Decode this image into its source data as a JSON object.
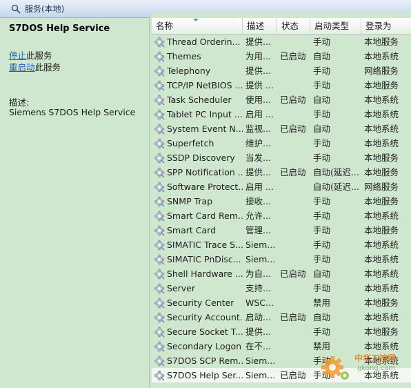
{
  "window": {
    "title": "服务(本地)",
    "icon": "search-icon"
  },
  "left_pane": {
    "service_title": "S7DOS Help Service",
    "stop_link": "停止",
    "stop_suffix": "此服务",
    "restart_link": "重启动",
    "restart_suffix": "此服务",
    "description_label": "描述:",
    "description_text": "Siemens S7DOS Help Service"
  },
  "table": {
    "columns": [
      "名称",
      "描述",
      "状态",
      "启动类型",
      "登录为"
    ],
    "row_icon": "gear-icon",
    "rows": [
      {
        "name": "Thread Orderin...",
        "desc": "提供...",
        "status": "",
        "startup": "手动",
        "logon": "本地服务"
      },
      {
        "name": "Themes",
        "desc": "为用...",
        "status": "已启动",
        "startup": "自动",
        "logon": "本地系统"
      },
      {
        "name": "Telephony",
        "desc": "提供...",
        "status": "",
        "startup": "手动",
        "logon": "网络服务"
      },
      {
        "name": "TCP/IP NetBIOS ...",
        "desc": "提供 ...",
        "status": "",
        "startup": "手动",
        "logon": "本地服务"
      },
      {
        "name": "Task Scheduler",
        "desc": "使用...",
        "status": "已启动",
        "startup": "自动",
        "logon": "本地系统"
      },
      {
        "name": "Tablet PC Input ...",
        "desc": "启用 ...",
        "status": "",
        "startup": "手动",
        "logon": "本地系统"
      },
      {
        "name": "System Event N...",
        "desc": "监视...",
        "status": "已启动",
        "startup": "自动",
        "logon": "本地系统"
      },
      {
        "name": "Superfetch",
        "desc": "维护...",
        "status": "",
        "startup": "手动",
        "logon": "本地系统"
      },
      {
        "name": "SSDP Discovery",
        "desc": "当发...",
        "status": "",
        "startup": "手动",
        "logon": "本地服务"
      },
      {
        "name": "SPP Notification ...",
        "desc": "提供...",
        "status": "已启动",
        "startup": "自动(延迟...",
        "logon": "本地服务"
      },
      {
        "name": "Software Protect...",
        "desc": "启用 ...",
        "status": "",
        "startup": "自动(延迟...",
        "logon": "网络服务"
      },
      {
        "name": "SNMP Trap",
        "desc": "接收...",
        "status": "",
        "startup": "手动",
        "logon": "本地服务"
      },
      {
        "name": "Smart Card Rem...",
        "desc": "允许...",
        "status": "",
        "startup": "手动",
        "logon": "本地系统"
      },
      {
        "name": "Smart Card",
        "desc": "管理...",
        "status": "",
        "startup": "手动",
        "logon": "本地服务"
      },
      {
        "name": "SIMATIC Trace S...",
        "desc": "Siem...",
        "status": "",
        "startup": "手动",
        "logon": "本地系统"
      },
      {
        "name": "SIMATIC PnDisc...",
        "desc": "Siem...",
        "status": "",
        "startup": "手动",
        "logon": "本地系统"
      },
      {
        "name": "Shell Hardware ...",
        "desc": "为自...",
        "status": "已启动",
        "startup": "自动",
        "logon": "本地系统"
      },
      {
        "name": "Server",
        "desc": "支持...",
        "status": "",
        "startup": "手动",
        "logon": "本地系统"
      },
      {
        "name": "Security Center",
        "desc": "WSC...",
        "status": "",
        "startup": "禁用",
        "logon": "本地服务"
      },
      {
        "name": "Security Account...",
        "desc": "启动...",
        "status": "已启动",
        "startup": "自动",
        "logon": "本地系统"
      },
      {
        "name": "Secure Socket T...",
        "desc": "提供...",
        "status": "",
        "startup": "手动",
        "logon": "本地服务"
      },
      {
        "name": "Secondary Logon",
        "desc": "在不...",
        "status": "",
        "startup": "禁用",
        "logon": "本地系统"
      },
      {
        "name": "S7DOS SCP Rem...",
        "desc": "Siem...",
        "status": "",
        "startup": "手动",
        "logon": "本地系统"
      },
      {
        "name": "S7DOS Help Ser...",
        "desc": "Siem...",
        "status": "已启动",
        "startup": "手动",
        "logon": "本地系统",
        "selected": true
      }
    ]
  },
  "watermark": {
    "line1": "中华工控网",
    "line2": "gkong.com"
  },
  "colors": {
    "background": "#cfe6cf",
    "link": "#1a5fb4",
    "titlebar": "#c6d7ea"
  }
}
